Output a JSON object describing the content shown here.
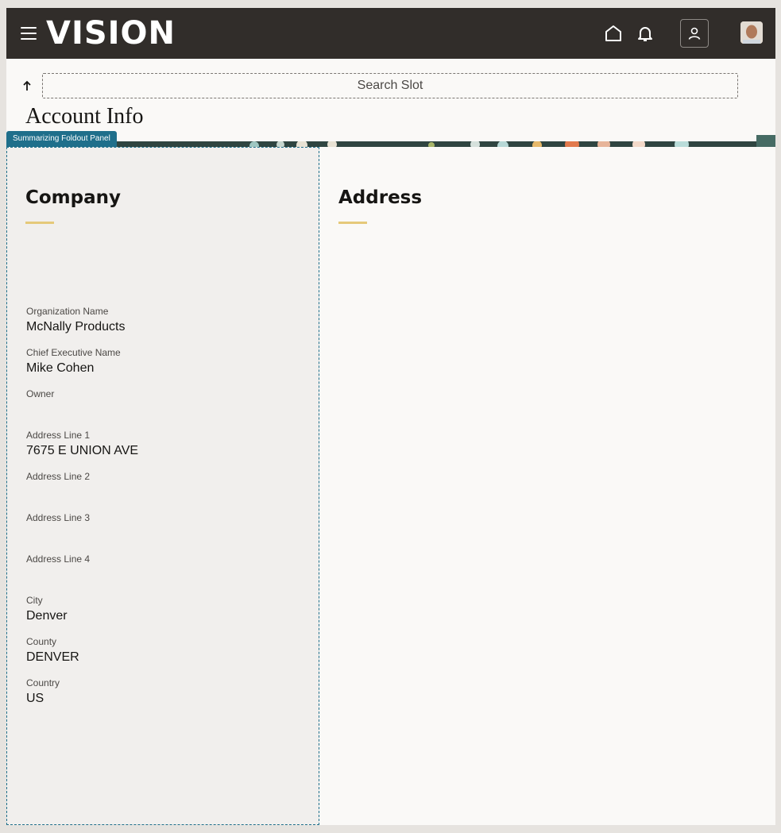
{
  "header": {
    "logo_text": "VISION",
    "icons": [
      "menu-icon",
      "home-icon",
      "bell-icon",
      "user-icon",
      "avatar"
    ]
  },
  "search": {
    "placeholder": "Search Slot"
  },
  "page": {
    "title": "Account Info",
    "badge": "Summarizing Foldout Panel"
  },
  "company": {
    "title": "Company",
    "fields": [
      {
        "label": "Organization Name",
        "value": "McNally Products"
      },
      {
        "label": "Chief Executive Name",
        "value": "Mike Cohen"
      },
      {
        "label": "Owner",
        "value": ""
      },
      {
        "label": "Address Line 1",
        "value": "7675 E UNION AVE"
      },
      {
        "label": "Address Line 2",
        "value": ""
      },
      {
        "label": "Address Line 3",
        "value": ""
      },
      {
        "label": "Address Line 4",
        "value": ""
      },
      {
        "label": "City",
        "value": "Denver"
      },
      {
        "label": "County",
        "value": "DENVER"
      },
      {
        "label": "Country",
        "value": "US"
      }
    ]
  },
  "address": {
    "title": "Address"
  },
  "colors": {
    "header_bg": "#312d2a",
    "accent_underline": "#e5c97a",
    "badge_bg": "#1f6f8b"
  }
}
